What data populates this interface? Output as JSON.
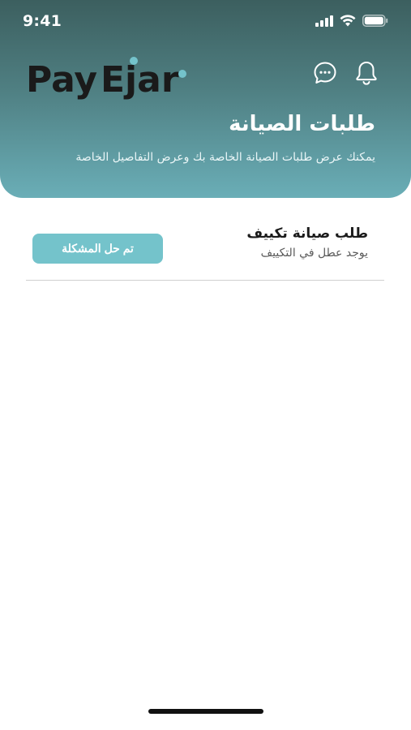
{
  "status_bar": {
    "time": "9:41",
    "icons": [
      "cellular-signal-icon",
      "wifi-icon",
      "battery-icon"
    ]
  },
  "header": {
    "logo": {
      "part1": "Pay",
      "part2": "Ejar",
      "accent_color": "#74c3cb",
      "text_color": "#1a1a1a"
    },
    "actions": [
      {
        "icon": "chat-bubble-icon"
      },
      {
        "icon": "bell-icon"
      }
    ],
    "title": "طلبات الصيانة",
    "subtitle": "يمكنك عرض طلبات الصيانة الخاصة بك وعرض التفاصيل الخاصة",
    "gradient": [
      "#3c5f5f",
      "#6aaeb7"
    ]
  },
  "requests": [
    {
      "title": "طلب صيانة تكييف",
      "description": "يوجد عطل في التكييف",
      "status_label": "تم حل المشكلة",
      "status_color": "#74c3cb"
    }
  ]
}
